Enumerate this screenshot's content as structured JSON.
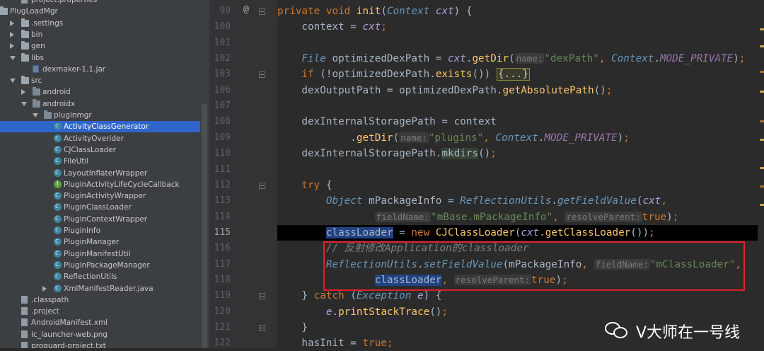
{
  "tree": {
    "items": [
      {
        "label": "project.properties",
        "icon": "file-icon",
        "indent": 44,
        "arrow": "none",
        "selected": false
      },
      {
        "label": "PlugLoadMgr",
        "icon": "folder-icon",
        "indent": 14,
        "arrow": "down",
        "selected": false
      },
      {
        "label": ".settings",
        "icon": "folder-icon",
        "indent": 44,
        "arrow": "right",
        "selected": false
      },
      {
        "label": "bin",
        "icon": "folder-icon",
        "indent": 44,
        "arrow": "right",
        "selected": false
      },
      {
        "label": "gen",
        "icon": "folder-icon",
        "indent": 44,
        "arrow": "right",
        "selected": false
      },
      {
        "label": "libs",
        "icon": "folder-icon",
        "indent": 44,
        "arrow": "down",
        "selected": false
      },
      {
        "label": "dexmaker-1.1.jar",
        "icon": "jar-icon",
        "indent": 60,
        "arrow": "none",
        "selected": false
      },
      {
        "label": "src",
        "icon": "folder-icon",
        "indent": 44,
        "arrow": "down",
        "selected": false
      },
      {
        "label": "android",
        "icon": "package-icon",
        "indent": 60,
        "arrow": "right",
        "selected": false
      },
      {
        "label": "androidx",
        "icon": "package-icon",
        "indent": 60,
        "arrow": "down",
        "selected": false
      },
      {
        "label": "pluginmgr",
        "icon": "package-icon",
        "indent": 76,
        "arrow": "down",
        "selected": false
      },
      {
        "label": "ActivityClassGenerator",
        "icon": "class-icon",
        "indent": 90,
        "arrow": "none",
        "selected": true
      },
      {
        "label": "ActivityOverider",
        "icon": "class-icon",
        "indent": 90,
        "arrow": "none",
        "selected": false
      },
      {
        "label": "CJClassLoader",
        "icon": "class-icon",
        "indent": 90,
        "arrow": "none",
        "selected": false
      },
      {
        "label": "FileUtil",
        "icon": "class-icon",
        "indent": 90,
        "arrow": "none",
        "selected": false
      },
      {
        "label": "LayoutInflaterWrapper",
        "icon": "class-icon",
        "indent": 90,
        "arrow": "none",
        "selected": false
      },
      {
        "label": "PluginActivityLifeCycleCallback",
        "icon": "interface-icon",
        "indent": 90,
        "arrow": "none",
        "selected": false
      },
      {
        "label": "PluginActivityWrapper",
        "icon": "class-icon",
        "indent": 90,
        "arrow": "none",
        "selected": false
      },
      {
        "label": "PluginClassLoader",
        "icon": "class-icon",
        "indent": 90,
        "arrow": "none",
        "selected": false
      },
      {
        "label": "PluginContextWrapper",
        "icon": "class-icon",
        "indent": 90,
        "arrow": "none",
        "selected": false
      },
      {
        "label": "PluginInfo",
        "icon": "class-icon",
        "indent": 90,
        "arrow": "none",
        "selected": false
      },
      {
        "label": "PluginManager",
        "icon": "class-icon",
        "indent": 90,
        "arrow": "none",
        "selected": false
      },
      {
        "label": "PluginManifestUtil",
        "icon": "class-icon",
        "indent": 90,
        "arrow": "none",
        "selected": false
      },
      {
        "label": "PluginPackageManager",
        "icon": "class-icon",
        "indent": 90,
        "arrow": "none",
        "selected": false
      },
      {
        "label": "ReflectionUtils",
        "icon": "class-icon",
        "indent": 90,
        "arrow": "none",
        "selected": false
      },
      {
        "label": "XmlManifestReader.java",
        "icon": "class-icon",
        "indent": 90,
        "arrow": "right",
        "selected": false
      },
      {
        "label": ".classpath",
        "icon": "file-icon",
        "indent": 44,
        "arrow": "none",
        "selected": false
      },
      {
        "label": ".project",
        "icon": "file-icon",
        "indent": 44,
        "arrow": "none",
        "selected": false
      },
      {
        "label": "AndroidManifest.xml",
        "icon": "file-icon",
        "indent": 44,
        "arrow": "none",
        "selected": false
      },
      {
        "label": "ic_launcher-web.png",
        "icon": "file-icon",
        "indent": 44,
        "arrow": "none",
        "selected": false
      },
      {
        "label": "proguard-project.txt",
        "icon": "file-icon",
        "indent": 44,
        "arrow": "none",
        "selected": false
      }
    ]
  },
  "editor": {
    "current_line": "115",
    "annotation_marker": "@",
    "line_numbers": [
      "99",
      "100",
      "101",
      "102",
      "103",
      "106",
      "107",
      "108",
      "109",
      "110",
      "111",
      "112",
      "113",
      "114",
      "115",
      "116",
      "117",
      "118",
      "119",
      "120",
      "121",
      "122"
    ],
    "code": [
      [
        {
          "c": "kw",
          "t": "private void "
        },
        {
          "c": "mth",
          "t": "init"
        },
        {
          "c": "",
          "t": "("
        },
        {
          "c": "ty",
          "t": "Context "
        },
        {
          "c": "vr",
          "t": "cxt"
        },
        {
          "c": "",
          "t": ") {"
        }
      ],
      [
        {
          "c": "",
          "t": "    context = "
        },
        {
          "c": "vr",
          "t": "cxt"
        },
        {
          "c": "kw",
          "t": ";"
        }
      ],
      [],
      [
        {
          "c": "ty",
          "t": "    File "
        },
        {
          "c": "",
          "t": "optimizedDexPath = "
        },
        {
          "c": "vr",
          "t": "cxt"
        },
        {
          "c": "",
          "t": "."
        },
        {
          "c": "mth",
          "t": "getDir"
        },
        {
          "c": "",
          "t": "("
        },
        {
          "c": "hint",
          "t": "name:"
        },
        {
          "c": "str",
          "t": "\"dexPath\""
        },
        {
          "c": "kw",
          "t": ", "
        },
        {
          "c": "ty",
          "t": "Context"
        },
        {
          "c": "",
          "t": "."
        },
        {
          "c": "typ",
          "t": "MODE_PRIVATE"
        },
        {
          "c": "",
          "t": ")"
        },
        {
          "c": "kw",
          "t": ";"
        }
      ],
      [
        {
          "c": "kw",
          "t": "    if "
        },
        {
          "c": "",
          "t": "(!optimizedDexPath."
        },
        {
          "c": "mth",
          "t": "exists"
        },
        {
          "c": "",
          "t": "()) "
        },
        {
          "c": "fold-box",
          "t": "{...}"
        }
      ],
      [
        {
          "c": "",
          "t": "    dexOutputPath = optimizedDexPath."
        },
        {
          "c": "mth",
          "t": "getAbsolutePath"
        },
        {
          "c": "",
          "t": "()"
        },
        {
          "c": "kw",
          "t": ";"
        }
      ],
      [],
      [
        {
          "c": "",
          "t": "    dexInternalStoragePath = context"
        }
      ],
      [
        {
          "c": "",
          "t": "            ."
        },
        {
          "c": "mth",
          "t": "getDir"
        },
        {
          "c": "",
          "t": "("
        },
        {
          "c": "hint",
          "t": "name:"
        },
        {
          "c": "str",
          "t": "\"plugins\""
        },
        {
          "c": "kw",
          "t": ", "
        },
        {
          "c": "ty",
          "t": "Context"
        },
        {
          "c": "",
          "t": "."
        },
        {
          "c": "typ",
          "t": "MODE_PRIVATE"
        },
        {
          "c": "",
          "t": ")"
        },
        {
          "c": "kw",
          "t": ";"
        }
      ],
      [
        {
          "c": "",
          "t": "    dexInternalStoragePath."
        },
        {
          "c": "mkd",
          "t": "mkdirs"
        },
        {
          "c": "",
          "t": "()"
        },
        {
          "c": "kw",
          "t": ";"
        }
      ],
      [],
      [
        {
          "c": "kw",
          "t": "    try "
        },
        {
          "c": "",
          "t": "{"
        }
      ],
      [
        {
          "c": "ty",
          "t": "        Object "
        },
        {
          "c": "",
          "t": "mPackageInfo = "
        },
        {
          "c": "ty",
          "t": "ReflectionUtils"
        },
        {
          "c": "",
          "t": "."
        },
        {
          "c": "ty",
          "t": "getFieldValue"
        },
        {
          "c": "",
          "t": "("
        },
        {
          "c": "vr",
          "t": "cxt"
        },
        {
          "c": "kw",
          "t": ","
        }
      ],
      [
        {
          "c": "",
          "t": "                "
        },
        {
          "c": "hint",
          "t": "fieldName:"
        },
        {
          "c": "str",
          "t": "\"mBase.mPackageInfo\""
        },
        {
          "c": "kw",
          "t": ", "
        },
        {
          "c": "hint",
          "t": "resolveParent:"
        },
        {
          "c": "kw",
          "t": "true"
        },
        {
          "c": "",
          "t": ")"
        },
        {
          "c": "kw",
          "t": ";"
        }
      ],
      [
        {
          "c": "",
          "t": "        "
        },
        {
          "c": "hl",
          "t": "classLoader"
        },
        {
          "c": "",
          "t": " = "
        },
        {
          "c": "kw",
          "t": "new "
        },
        {
          "c": "mth",
          "t": "CJClassLoader"
        },
        {
          "c": "",
          "t": "("
        },
        {
          "c": "vr",
          "t": "cxt"
        },
        {
          "c": "",
          "t": "."
        },
        {
          "c": "mth",
          "t": "getClassLoader"
        },
        {
          "c": "",
          "t": "())"
        },
        {
          "c": "kw",
          "t": ";"
        }
      ],
      [
        {
          "c": "cm",
          "t": "        // 反射修改Application的classloader"
        }
      ],
      [
        {
          "c": "ty",
          "t": "        ReflectionUtils"
        },
        {
          "c": "",
          "t": "."
        },
        {
          "c": "ty",
          "t": "setFieldValue"
        },
        {
          "c": "",
          "t": "(mPackageInfo"
        },
        {
          "c": "kw",
          "t": ", "
        },
        {
          "c": "hint",
          "t": "fieldName:"
        },
        {
          "c": "str",
          "t": "\"mClassLoader\""
        },
        {
          "c": "kw",
          "t": ","
        }
      ],
      [
        {
          "c": "",
          "t": "                "
        },
        {
          "c": "hl",
          "t": "classLoader"
        },
        {
          "c": "kw",
          "t": ", "
        },
        {
          "c": "hint",
          "t": "resolveParent:"
        },
        {
          "c": "kw",
          "t": "true"
        },
        {
          "c": "",
          "t": ")"
        },
        {
          "c": "kw",
          "t": ";"
        }
      ],
      [
        {
          "c": "",
          "t": "    } "
        },
        {
          "c": "kw",
          "t": "catch "
        },
        {
          "c": "",
          "t": "("
        },
        {
          "c": "ty",
          "t": "Exception "
        },
        {
          "c": "vr",
          "t": "e"
        },
        {
          "c": "",
          "t": ") {"
        }
      ],
      [
        {
          "c": "vr",
          "t": "        e"
        },
        {
          "c": "",
          "t": "."
        },
        {
          "c": "mth",
          "t": "printStackTrace"
        },
        {
          "c": "",
          "t": "()"
        },
        {
          "c": "kw",
          "t": ";"
        }
      ],
      [
        {
          "c": "",
          "t": "    }"
        }
      ],
      [
        {
          "c": "",
          "t": "    hasInit = "
        },
        {
          "c": "kw",
          "t": "true"
        },
        {
          "c": "kw",
          "t": ";"
        }
      ]
    ]
  },
  "watermark": {
    "icon": "wechat-icon",
    "text": "V大师在一号线"
  }
}
